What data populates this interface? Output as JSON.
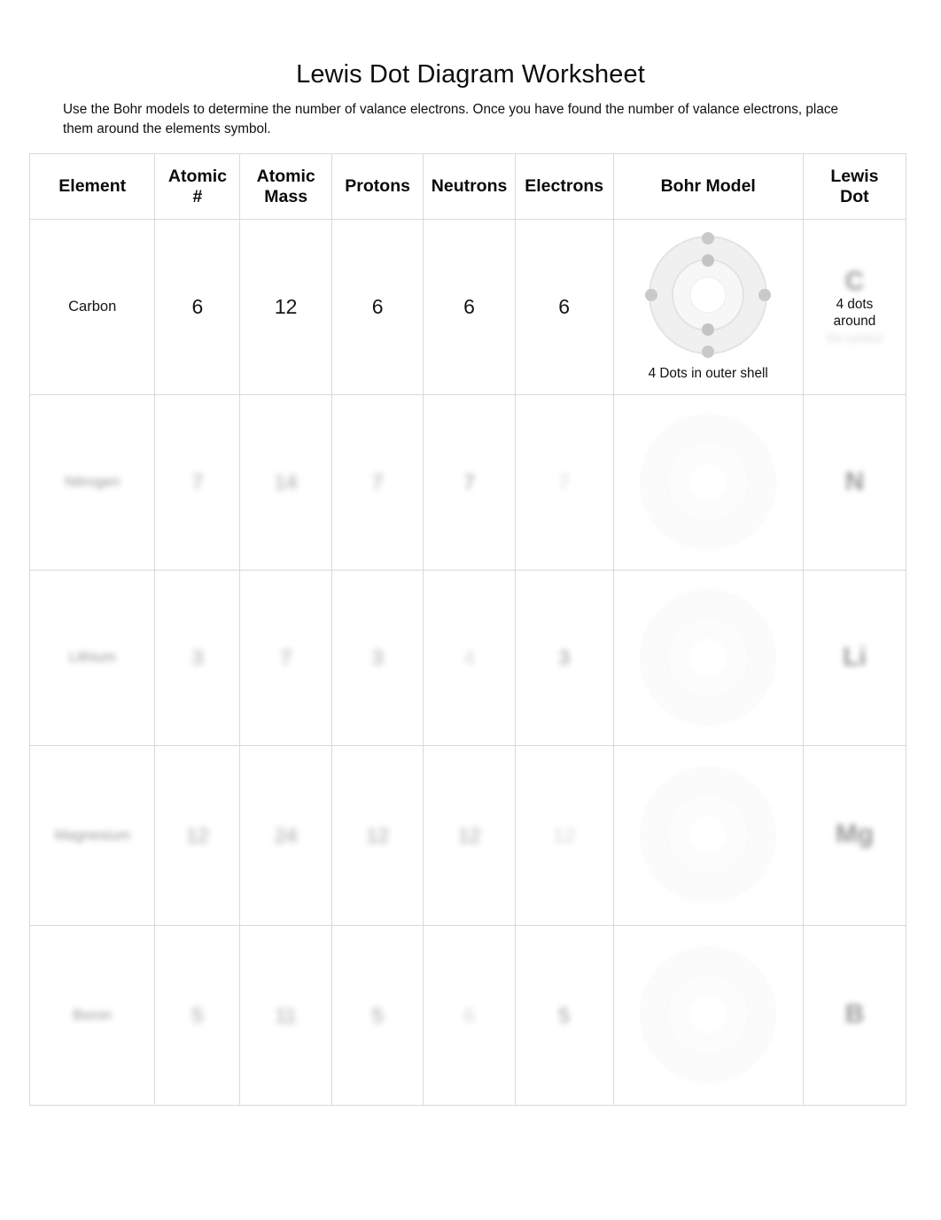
{
  "document": {
    "title": "Lewis Dot Diagram Worksheet",
    "instructions": "Use the Bohr models to determine the number of valance electrons. Once you have found the number of valance electrons, place them around the elements symbol."
  },
  "table": {
    "headers": [
      "Element",
      "Atomic\n#",
      "Atomic\nMass",
      "Protons",
      "Neutrons",
      "Electrons",
      "Bohr Model",
      "Lewis\nDot"
    ],
    "header_lines": {
      "element": "Element",
      "atomic_number_1": "Atomic",
      "atomic_number_2": "#",
      "atomic_mass_1": "Atomic",
      "atomic_mass_2": "Mass",
      "protons": "Protons",
      "neutrons": "Neutrons",
      "electrons": "Electrons",
      "bohr_model": "Bohr Model",
      "lewis_dot_1": "Lewis",
      "lewis_dot_2": "Dot"
    },
    "rows": [
      {
        "element": "Carbon",
        "atomic_number": "6",
        "atomic_mass": "12",
        "protons": "6",
        "neutrons": "6",
        "electrons": "6",
        "bohr_caption": "4 Dots in outer shell",
        "bohr_shells": [
          2,
          4
        ],
        "lewis_symbol": "C",
        "lewis_note": "4 dots\naround",
        "lewis_note_line1": "4 dots",
        "lewis_note_line2": "around",
        "lewis_subnote": "the symbol",
        "legible": true
      },
      {
        "element": "Nitrogen",
        "atomic_number": "7",
        "atomic_mass": "14",
        "protons": "7",
        "neutrons": "7",
        "electrons": "7",
        "bohr_caption": "",
        "bohr_shells": [
          2,
          5
        ],
        "lewis_symbol": "N",
        "lewis_note": "",
        "lewis_note_line1": "",
        "lewis_note_line2": "",
        "lewis_subnote": "",
        "legible": false
      },
      {
        "element": "Lithium",
        "atomic_number": "3",
        "atomic_mass": "7",
        "protons": "3",
        "neutrons": "4",
        "electrons": "3",
        "bohr_caption": "",
        "bohr_shells": [
          2,
          1
        ],
        "lewis_symbol": "Li",
        "lewis_note": "",
        "lewis_note_line1": "",
        "lewis_note_line2": "",
        "lewis_subnote": "",
        "legible": false
      },
      {
        "element": "Magnesium",
        "atomic_number": "12",
        "atomic_mass": "24",
        "protons": "12",
        "neutrons": "12",
        "electrons": "12",
        "bohr_caption": "",
        "bohr_shells": [
          2,
          8,
          2
        ],
        "lewis_symbol": "Mg",
        "lewis_note": "",
        "lewis_note_line1": "",
        "lewis_note_line2": "",
        "lewis_subnote": "",
        "legible": false
      },
      {
        "element": "Boron",
        "atomic_number": "5",
        "atomic_mass": "11",
        "protons": "5",
        "neutrons": "6",
        "electrons": "5",
        "bohr_caption": "",
        "bohr_shells": [
          2,
          3
        ],
        "lewis_symbol": "B",
        "lewis_note": "",
        "lewis_note_line1": "",
        "lewis_note_line2": "",
        "lewis_subnote": "",
        "legible": false
      }
    ]
  },
  "colors": {
    "page_background": "#ffffff",
    "text": "#101010",
    "table_border": "#d9d9d9",
    "redacted_text": "#5a5a5a"
  }
}
